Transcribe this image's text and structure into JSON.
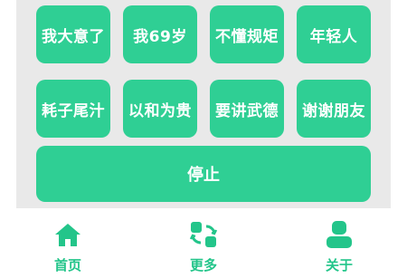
{
  "buttons": [
    {
      "label": "我大意了"
    },
    {
      "label": "我69岁"
    },
    {
      "label": "不懂规矩"
    },
    {
      "label": "年轻人"
    },
    {
      "label": "耗子尾汁"
    },
    {
      "label": "以和为贵"
    },
    {
      "label": "要讲武德"
    },
    {
      "label": "谢谢朋友"
    }
  ],
  "stop_button": {
    "label": "停止"
  },
  "tabbar": {
    "tabs": [
      {
        "label": "首页",
        "icon": "home-icon"
      },
      {
        "label": "更多",
        "icon": "more-icon"
      },
      {
        "label": "关于",
        "icon": "user-icon"
      }
    ]
  },
  "colors": {
    "accent": "#2fcf94",
    "tab_accent": "#23c58a",
    "panel": "#e9e9e9",
    "background": "#ffffff"
  }
}
